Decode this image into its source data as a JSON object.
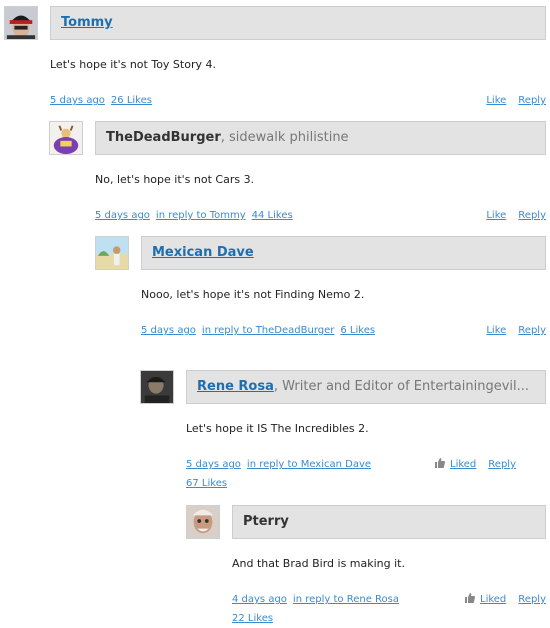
{
  "comments": [
    {
      "author": "Tommy",
      "author_desc": "",
      "text": "Let's hope it's not Toy Story 4.",
      "time": "5 days ago",
      "reply_to": "",
      "likes": "26 Likes",
      "like_label": "Like",
      "reply_label": "Reply"
    },
    {
      "author": "TheDeadBurger",
      "author_desc": ", sidewalk philistine",
      "text": "No, let's hope it's not Cars 3.",
      "time": "5 days ago",
      "reply_to": "in reply to Tommy",
      "likes": "44 Likes",
      "like_label": "Like",
      "reply_label": "Reply"
    },
    {
      "author": "Mexican Dave",
      "author_desc": "",
      "text": "Nooo, let's hope it's not Finding Nemo 2.",
      "time": "5 days ago",
      "reply_to": "in reply to TheDeadBurger",
      "likes": "6 Likes",
      "like_label": "Like",
      "reply_label": "Reply"
    },
    {
      "author": "Rene Rosa",
      "author_desc": ", Writer and Editor of Entertainingevil...",
      "text": "Let's hope it IS The Incredibles 2.",
      "time": "5 days ago",
      "reply_to": "in reply to Mexican Dave",
      "likes": "67 Likes",
      "like_label": "Liked",
      "reply_label": "Reply"
    },
    {
      "author": "Pterry",
      "author_desc": "",
      "text": "And that Brad Bird is making it.",
      "time": "4 days ago",
      "reply_to": "in reply to Rene Rosa",
      "likes": "22 Likes",
      "like_label": "Liked",
      "reply_label": "Reply"
    }
  ],
  "colors": {
    "link": "#3a8ad0",
    "author_link": "#1f6fb0",
    "namebar_bg": "#e3e3e3"
  }
}
